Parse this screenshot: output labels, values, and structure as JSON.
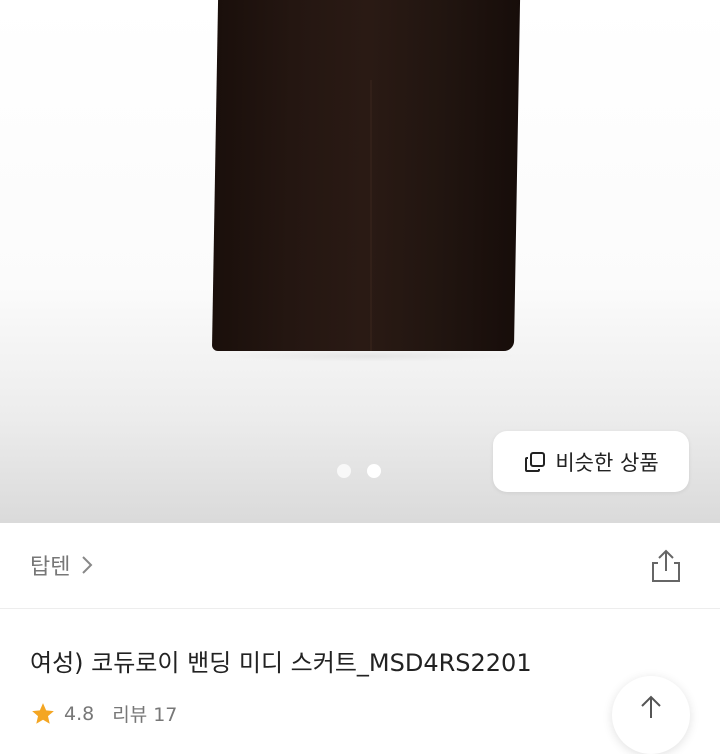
{
  "gallery": {
    "page_count": 2,
    "active_index": 1,
    "similar_button_label": "비슷한 상품"
  },
  "store": {
    "name": "탑텐"
  },
  "product": {
    "title": "여성) 코듀로이 밴딩 미디 스커트_MSD4RS2201",
    "rating": "4.8",
    "review_label": "리뷰 17"
  },
  "icons": {
    "similar": "copy-icon",
    "store_arrow": "chevron-right-icon",
    "share": "share-icon",
    "rating": "star-icon",
    "scroll_top": "arrow-up-icon"
  },
  "colors": {
    "star": "#f4a623",
    "text_primary": "#222222",
    "text_secondary": "#777777"
  }
}
